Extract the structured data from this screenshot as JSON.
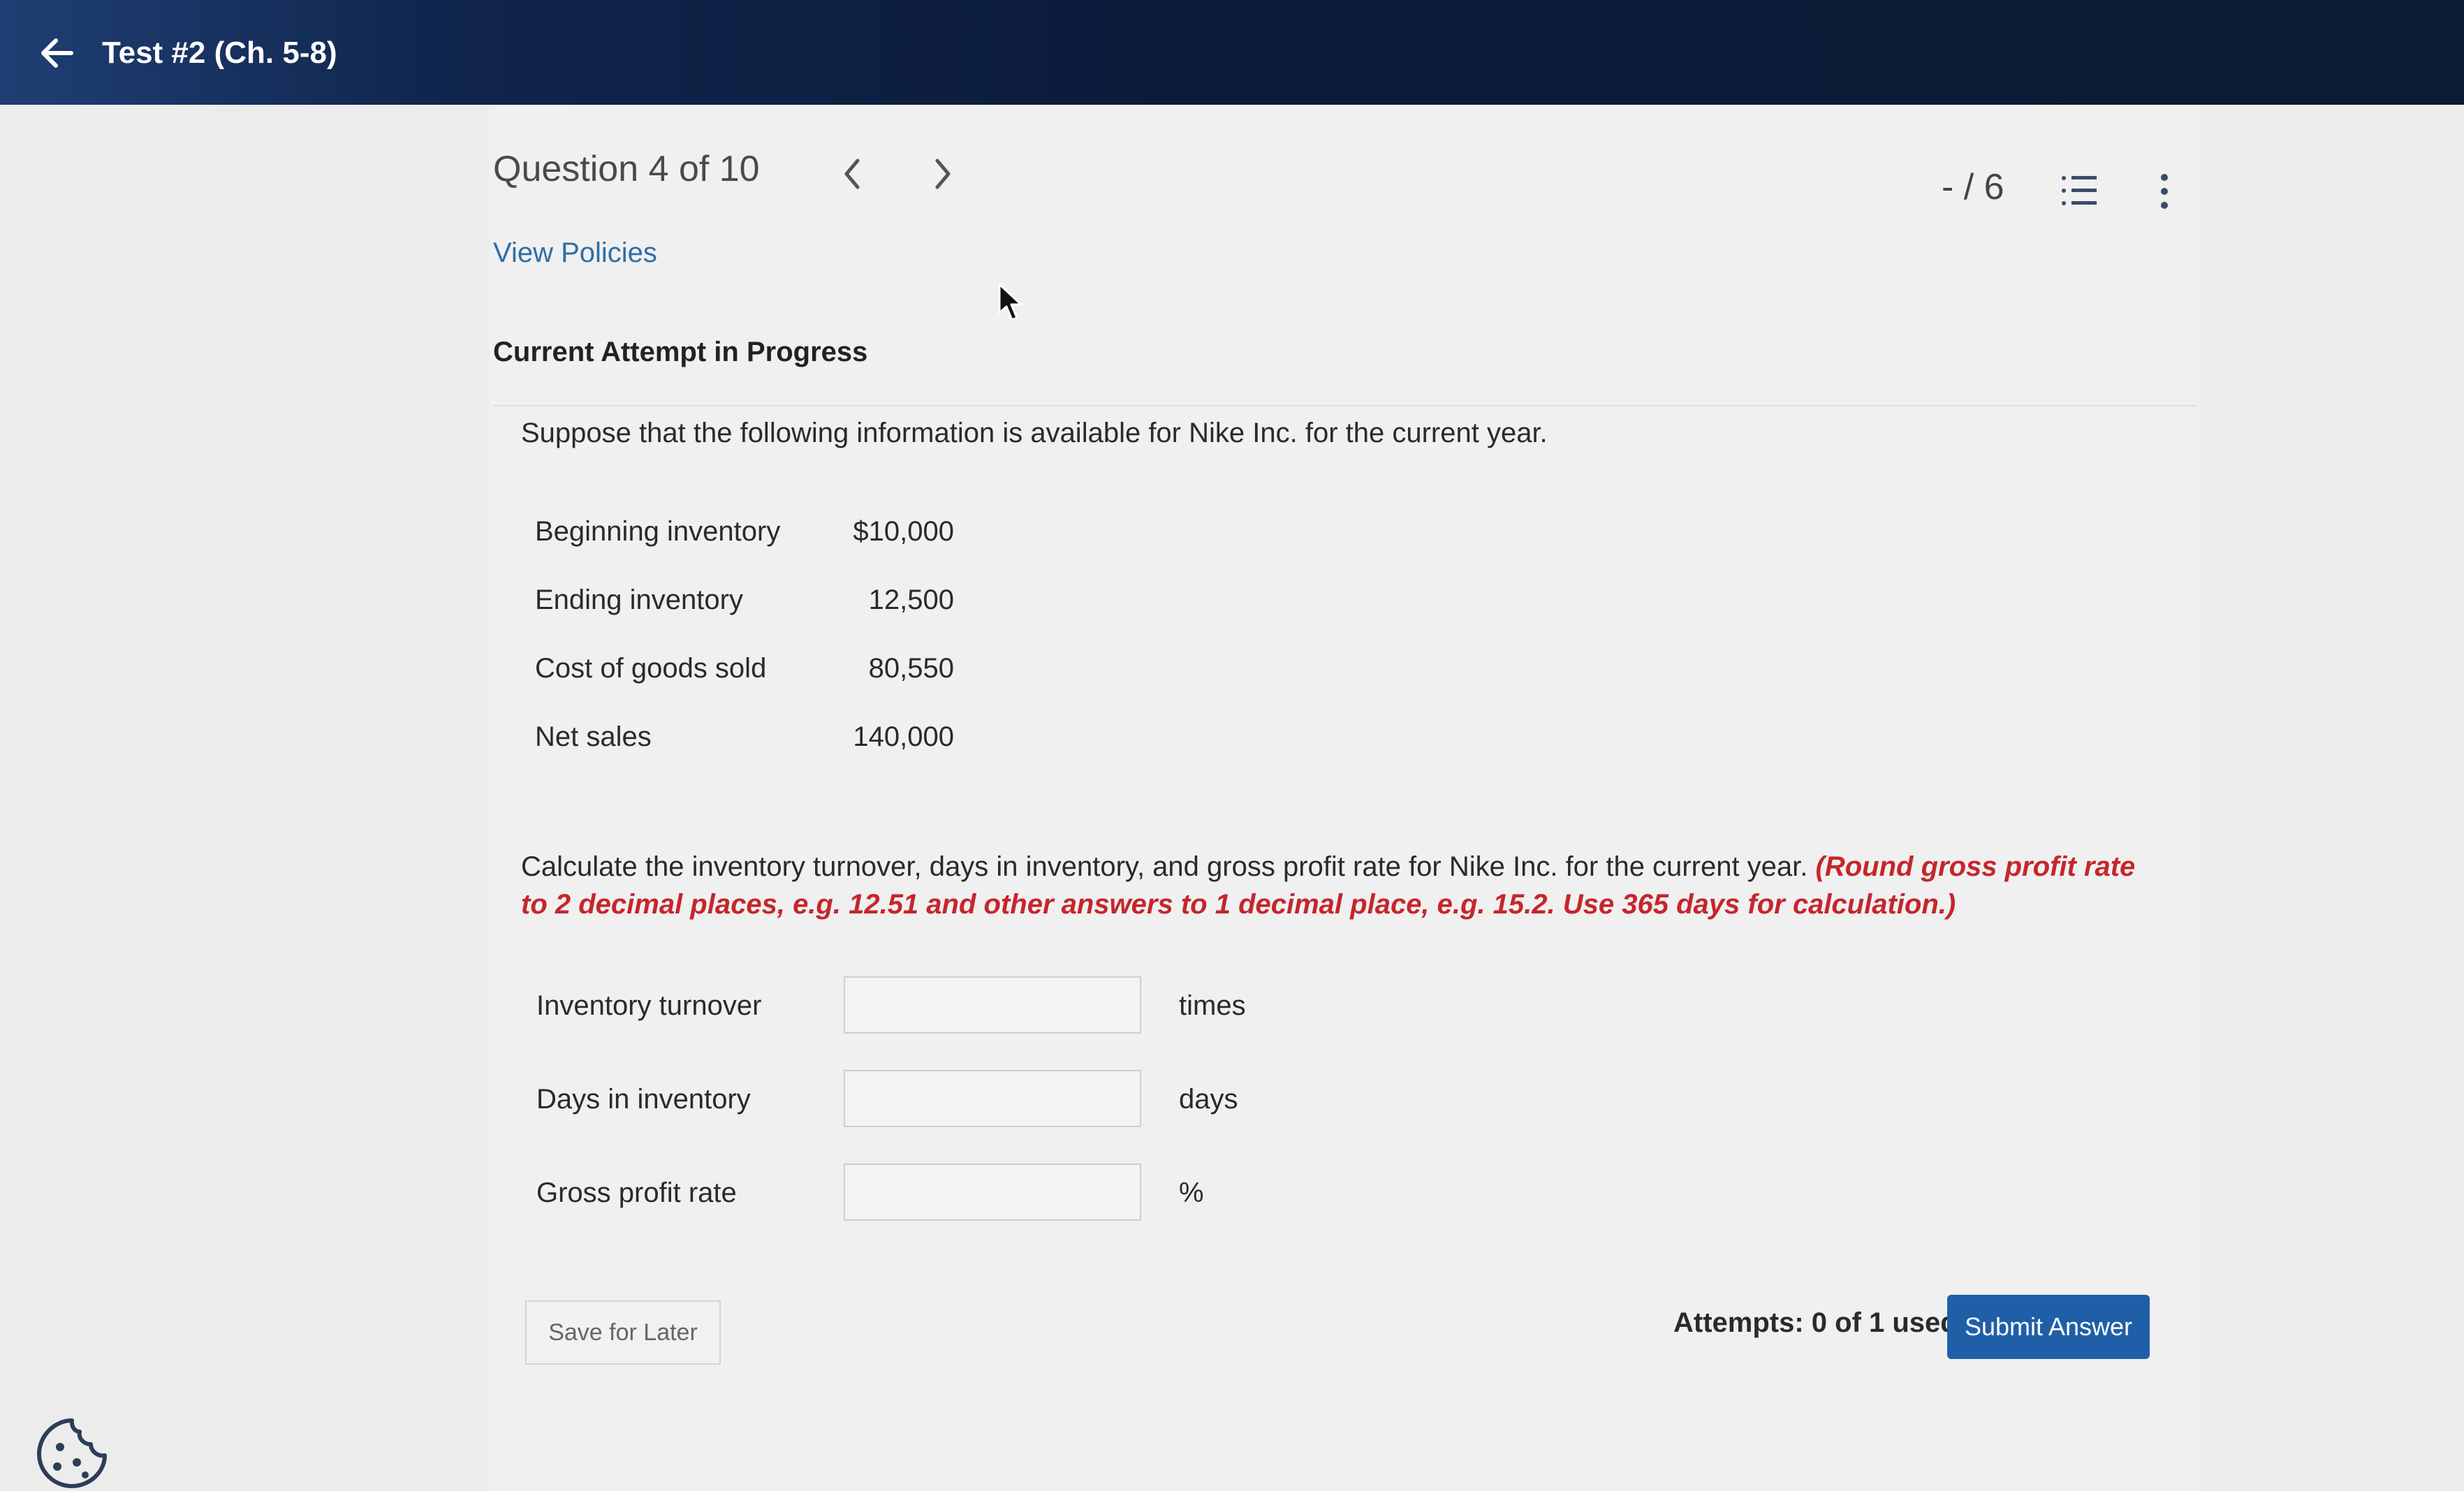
{
  "app": {
    "title": "Test #2 (Ch. 5-8)"
  },
  "question": {
    "header": "Question 4 of 10",
    "score": "- / 6",
    "view_policies": "View Policies",
    "attempt_status": "Current Attempt in Progress",
    "intro": "Suppose that the following information is available for Nike Inc. for the current year.",
    "data_rows": [
      {
        "label": "Beginning inventory",
        "value": "$10,000"
      },
      {
        "label": "Ending inventory",
        "value": "12,500"
      },
      {
        "label": "Cost of goods sold",
        "value": "80,550"
      },
      {
        "label": "Net sales",
        "value": "140,000"
      }
    ],
    "instructions": "Calculate the inventory turnover, days in inventory, and gross profit rate for Nike Inc. for the current year.",
    "instructions_note": "(Round gross profit rate to 2 decimal places, e.g. 12.51 and other answers to 1 decimal place, e.g. 15.2. Use 365 days for calculation.)",
    "answers": [
      {
        "label": "Inventory turnover",
        "value": "",
        "unit": "times"
      },
      {
        "label": "Days in inventory",
        "value": "",
        "unit": "days"
      },
      {
        "label": "Gross profit rate",
        "value": "",
        "unit": "%"
      }
    ]
  },
  "footer": {
    "save_label": "Save for Later",
    "attempts": "Attempts: 0 of 1 used",
    "submit_label": "Submit Answer"
  },
  "icons": {
    "back": "arrow-left-icon",
    "prev": "chevron-left-icon",
    "next": "chevron-right-icon",
    "list": "list-icon",
    "more": "more-vertical-icon",
    "cookie": "cookie-icon"
  },
  "colors": {
    "header_bg": "#0b1a38",
    "link": "#2e6ea6",
    "note_red": "#c5262c",
    "submit_bg": "#1f5fa8"
  }
}
